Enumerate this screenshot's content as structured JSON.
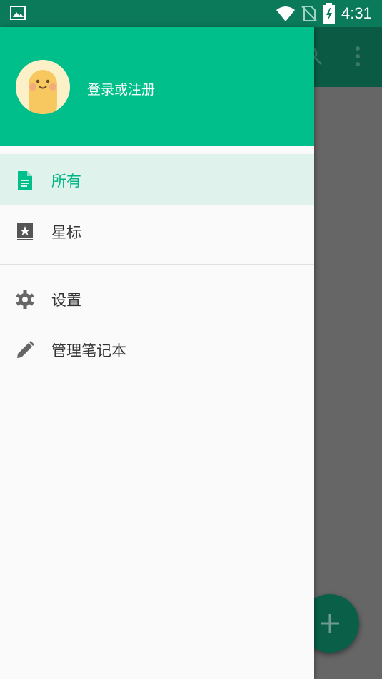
{
  "status_bar": {
    "time": "4:31",
    "icons": [
      "image-icon",
      "wifi-icon",
      "no-sim-icon",
      "battery-charging-icon"
    ]
  },
  "drawer": {
    "login_label": "登录或注册",
    "primary_items": [
      {
        "label": "所有",
        "icon": "document-icon",
        "active": true
      },
      {
        "label": "星标",
        "icon": "star-book-icon",
        "active": false
      }
    ],
    "secondary_items": [
      {
        "label": "设置",
        "icon": "gear-icon"
      },
      {
        "label": "管理笔记本",
        "icon": "pencil-icon"
      }
    ]
  },
  "colors": {
    "accent": "#00bf8a",
    "active_bg": "#dff3ec",
    "active_text": "#00b483",
    "status_bar": "#0b7a5a"
  },
  "background_app": {
    "toolbar_icons": [
      "search-icon",
      "more-vert-icon"
    ],
    "fab_icon": "plus-icon"
  }
}
